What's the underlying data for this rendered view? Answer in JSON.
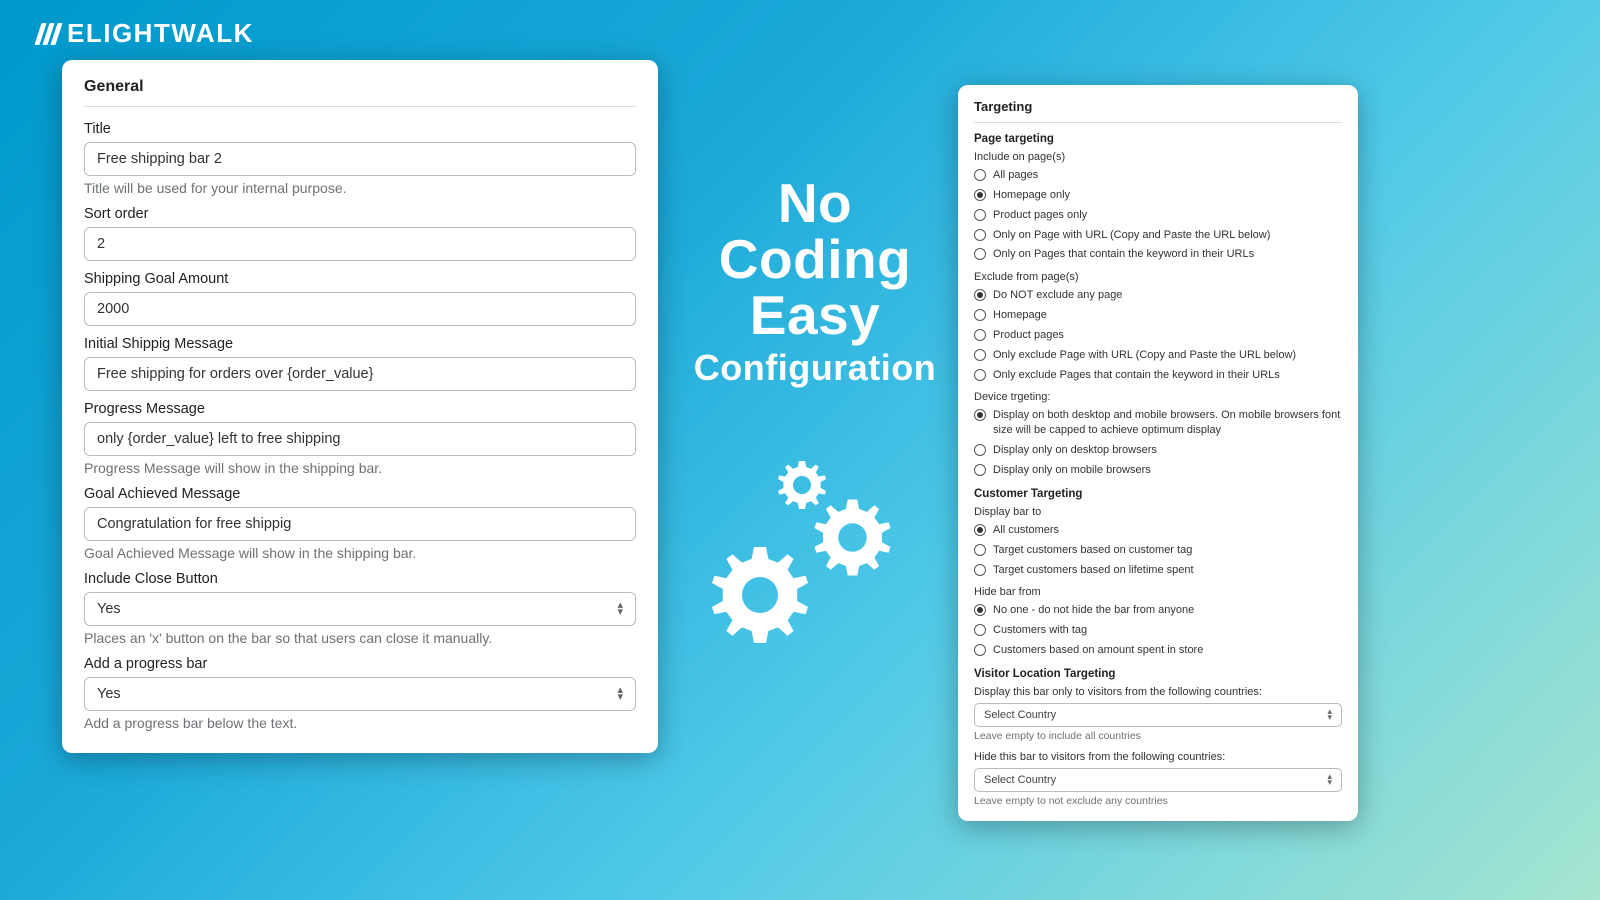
{
  "brand": "ELIGHTWALK",
  "hero": {
    "line1": "No Coding",
    "line2": "Easy",
    "line3": "Configuration"
  },
  "general": {
    "title": "General",
    "fields": {
      "title_label": "Title",
      "title_value": "Free shipping bar 2",
      "title_help": "Title will be used for your internal purpose.",
      "sort_label": "Sort order",
      "sort_value": "2",
      "goal_label": "Shipping Goal Amount",
      "goal_value": "2000",
      "initial_label": "Initial Shippig Message",
      "initial_value": "Free shipping for orders over  {order_value}",
      "progress_label": "Progress Message",
      "progress_value": "only {order_value} left to free shipping",
      "progress_help": "Progress Message will show in the shipping bar.",
      "achieved_label": "Goal Achieved Message",
      "achieved_value": "Congratulation for free shippig",
      "achieved_help": "Goal Achieved Message will show in the shipping bar.",
      "close_label": "Include Close Button",
      "close_value": "Yes",
      "close_help": "Places an 'x' button on the bar so that users can close it manually.",
      "pbar_label": "Add a progress bar",
      "pbar_value": "Yes",
      "pbar_help": "Add a progress bar below the text."
    }
  },
  "targeting": {
    "title": "Targeting",
    "page_heading": "Page targeting",
    "include_label": "Include on page(s)",
    "include_options": [
      "All pages",
      "Homepage only",
      "Product pages only",
      "Only on Page with URL (Copy and Paste the URL below)",
      "Only on Pages that contain the keyword in their URLs"
    ],
    "include_selected": 1,
    "exclude_label": "Exclude from page(s)",
    "exclude_options": [
      "Do NOT exclude any page",
      "Homepage",
      "Product pages",
      "Only exclude Page with URL (Copy and Paste the URL below)",
      "Only exclude Pages that contain the keyword in their URLs"
    ],
    "exclude_selected": 0,
    "device_label": "Device trgeting:",
    "device_options": [
      "Display on both desktop and mobile browsers. On mobile browsers font size will be capped to achieve optimum display",
      "Display only on desktop browsers",
      "Display only on mobile browsers"
    ],
    "device_selected": 0,
    "customer_heading": "Customer Targeting",
    "display_to_label": "Display bar to",
    "display_to_options": [
      "All customers",
      "Target customers based on customer tag",
      "Target customers based on lifetime spent"
    ],
    "display_to_selected": 0,
    "hide_from_label": "Hide bar from",
    "hide_from_options": [
      "No one - do not hide the bar from anyone",
      "Customers with tag",
      "Customers based on amount spent in store"
    ],
    "hide_from_selected": 0,
    "location_heading": "Visitor Location Targeting",
    "display_country_label": "Display this bar only to visitors from the following countries:",
    "display_country_value": "Select Country",
    "display_country_help": "Leave empty to include all countries",
    "hide_country_label": "Hide this bar to visitors from the following countries:",
    "hide_country_value": "Select Country",
    "hide_country_help": "Leave empty to not exclude any countries"
  }
}
